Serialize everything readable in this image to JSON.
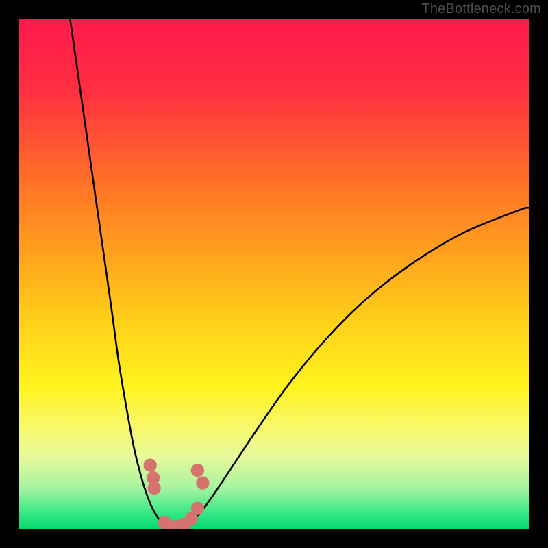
{
  "attribution": "TheBottleneck.com",
  "colors": {
    "frame": "#000000",
    "gradient_stops": [
      {
        "offset": 0.0,
        "color": "#ff1a4d"
      },
      {
        "offset": 0.14,
        "color": "#ff2f41"
      },
      {
        "offset": 0.3,
        "color": "#ff6a2a"
      },
      {
        "offset": 0.46,
        "color": "#ffa21c"
      },
      {
        "offset": 0.6,
        "color": "#ffd21a"
      },
      {
        "offset": 0.72,
        "color": "#fff31e"
      },
      {
        "offset": 0.8,
        "color": "#f8f86a"
      },
      {
        "offset": 0.86,
        "color": "#e6f99b"
      },
      {
        "offset": 0.92,
        "color": "#a6f3a0"
      },
      {
        "offset": 0.97,
        "color": "#35e884"
      },
      {
        "offset": 1.0,
        "color": "#06d96e"
      }
    ],
    "curve": "#000000",
    "marker": "#d6736e"
  },
  "chart_data": {
    "type": "line",
    "title": "",
    "xlabel": "",
    "ylabel": "",
    "xlim": [
      0,
      100
    ],
    "ylim": [
      0,
      100
    ],
    "curve_left": {
      "comment": "x normalized 0..100 across plot width, y = bottleneck% (0 at bottom)",
      "x": [
        10,
        12,
        14,
        16,
        18,
        19.5,
        21,
        22.5,
        24,
        25.5,
        27,
        28.5
      ],
      "y": [
        100,
        86,
        72,
        58,
        44,
        33,
        24,
        16,
        10,
        5.5,
        2.5,
        0.8
      ]
    },
    "curve_flat": {
      "x": [
        28.5,
        30,
        31.5,
        33
      ],
      "y": [
        0.8,
        0.4,
        0.4,
        0.8
      ]
    },
    "curve_right": {
      "x": [
        33,
        35,
        38,
        42,
        47,
        53,
        60,
        68,
        77,
        87,
        98,
        100
      ],
      "y": [
        0.8,
        2.5,
        6.5,
        12.5,
        20,
        28.5,
        37,
        45,
        52,
        58,
        62.5,
        63
      ]
    },
    "markers": {
      "comment": "salmon dots near the trough",
      "points": [
        {
          "x": 25.7,
          "y": 12.5
        },
        {
          "x": 26.3,
          "y": 10.0
        },
        {
          "x": 26.5,
          "y": 8.0
        },
        {
          "x": 28.5,
          "y": 1.2
        },
        {
          "x": 29.3,
          "y": 0.6
        },
        {
          "x": 30.2,
          "y": 0.4
        },
        {
          "x": 31.3,
          "y": 0.5
        },
        {
          "x": 32.5,
          "y": 0.9
        },
        {
          "x": 33.8,
          "y": 2.0
        },
        {
          "x": 35.0,
          "y": 4.0
        },
        {
          "x": 35.0,
          "y": 11.5
        },
        {
          "x": 36.0,
          "y": 9.0
        }
      ],
      "radius": 1.3
    }
  }
}
